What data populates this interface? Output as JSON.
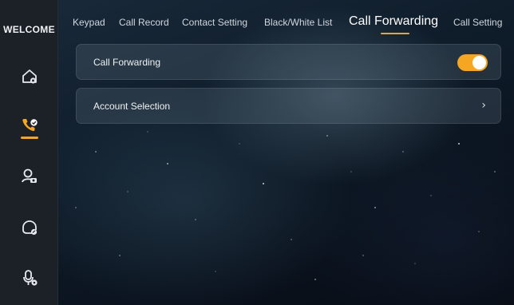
{
  "sidebar": {
    "brand": "WELCOME",
    "items": [
      {
        "icon": "home-icon"
      },
      {
        "icon": "phone-call-icon",
        "active": true
      },
      {
        "icon": "camera-user-icon"
      },
      {
        "icon": "headset-icon"
      },
      {
        "icon": "microphone-icon"
      }
    ]
  },
  "tabs": [
    {
      "label": "Keypad"
    },
    {
      "label": "Call Record"
    },
    {
      "label": "Contact Setting"
    },
    {
      "label": "Black/White List"
    },
    {
      "label": "Call Forwarding",
      "active": true
    },
    {
      "label": "Call Setting"
    }
  ],
  "settings": {
    "call_forwarding": {
      "label": "Call Forwarding",
      "enabled": true
    },
    "account_selection": {
      "label": "Account Selection",
      "icon": "chevron-right-icon",
      "chevron": "›"
    }
  },
  "colors": {
    "accent": "#f5a623",
    "sidebar": "#1c2027"
  }
}
